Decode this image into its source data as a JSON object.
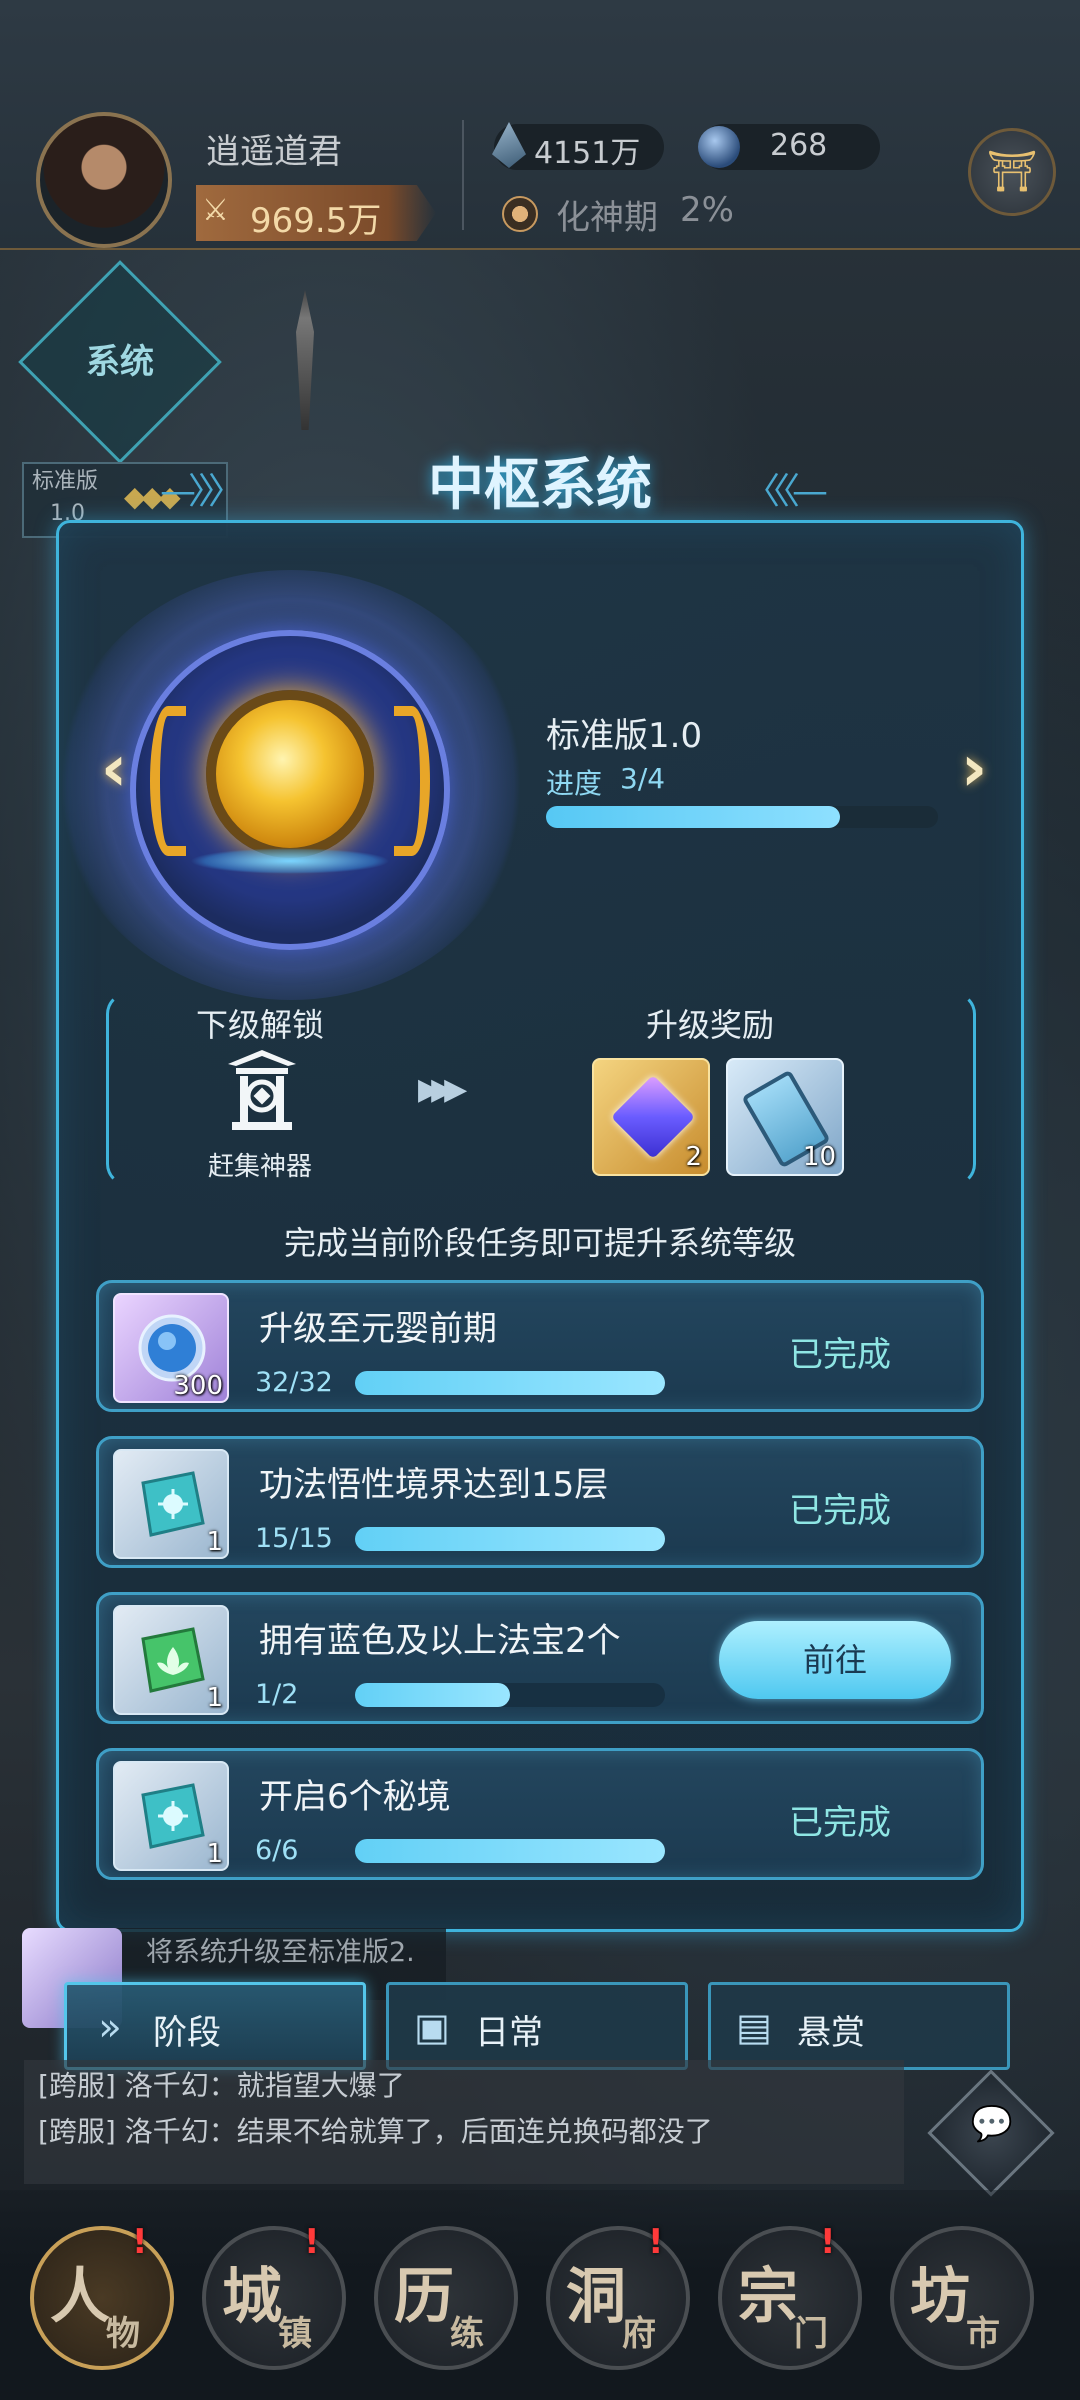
{
  "player": {
    "name": "逍遥道君",
    "power_value": "969.5万",
    "power_icon": "crossed-swords-icon"
  },
  "resources": [
    {
      "icon": "spirit-stone-icon",
      "value": "4151万"
    },
    {
      "icon": "blue-orb-icon",
      "value": "268"
    }
  ],
  "realm": {
    "name": "化神期",
    "percent": "2%"
  },
  "background": {
    "system_label": "系统",
    "version_tag_line1": "标准版",
    "version_tag_line2": "1.0"
  },
  "title": "中枢系统",
  "version": {
    "name": "标准版1.0",
    "progress_label": "进度",
    "progress_text": "3/4",
    "progress_fraction": 0.75
  },
  "unlock": {
    "title": "下级解锁",
    "item_name": "赶集神器"
  },
  "reward": {
    "title": "升级奖励",
    "items": [
      {
        "icon": "crystal-cube-icon",
        "count": "2"
      },
      {
        "icon": "scroll-icon",
        "count": "10"
      }
    ]
  },
  "hint": "完成当前阶段任务即可提升系统等级",
  "tasks": [
    {
      "title": "升级至元婴前期",
      "icon": "blue-orb-icon",
      "icon_count": "300",
      "progress_text": "32/32",
      "fraction": 1.0,
      "status": "已完成",
      "done": true
    },
    {
      "title": "功法悟性境界达到15层",
      "icon": "cyan-talisman-icon",
      "icon_count": "1",
      "progress_text": "15/15",
      "fraction": 1.0,
      "status": "已完成",
      "done": true
    },
    {
      "title": "拥有蓝色及以上法宝2个",
      "icon": "green-talisman-icon",
      "icon_count": "1",
      "progress_text": "1/2",
      "fraction": 0.5,
      "status": "前往",
      "done": false
    },
    {
      "title": "开启6个秘境",
      "icon": "cyan-talisman-icon",
      "icon_count": "1",
      "progress_text": "6/6",
      "fraction": 1.0,
      "status": "已完成",
      "done": true
    }
  ],
  "tip_text": "将系统升级至标准版2.",
  "tabs": [
    {
      "label": "阶段",
      "icon": "double-chevron-icon",
      "active": true
    },
    {
      "label": "日常",
      "icon": "calendar-icon",
      "active": false
    },
    {
      "label": "悬赏",
      "icon": "bounty-doc-icon",
      "active": false
    }
  ],
  "chat": [
    "[跨服] 洛千幻：就指望大爆了",
    "[跨服] 洛千幻：结果不给就算了，后面连兑换码都没了"
  ],
  "nav": [
    {
      "char1": "人",
      "char2": "物",
      "badge": true,
      "active": true
    },
    {
      "char1": "城",
      "char2": "镇",
      "badge": true,
      "active": false
    },
    {
      "char1": "历",
      "char2": "练",
      "badge": false,
      "active": false
    },
    {
      "char1": "洞",
      "char2": "府",
      "badge": true,
      "active": false
    },
    {
      "char1": "宗",
      "char2": "门",
      "badge": true,
      "active": false
    },
    {
      "char1": "坊",
      "char2": "市",
      "badge": false,
      "active": false
    }
  ],
  "colors": {
    "accent": "#3fb4dc",
    "done": "#8fe6e4",
    "gold": "#e8a628"
  }
}
